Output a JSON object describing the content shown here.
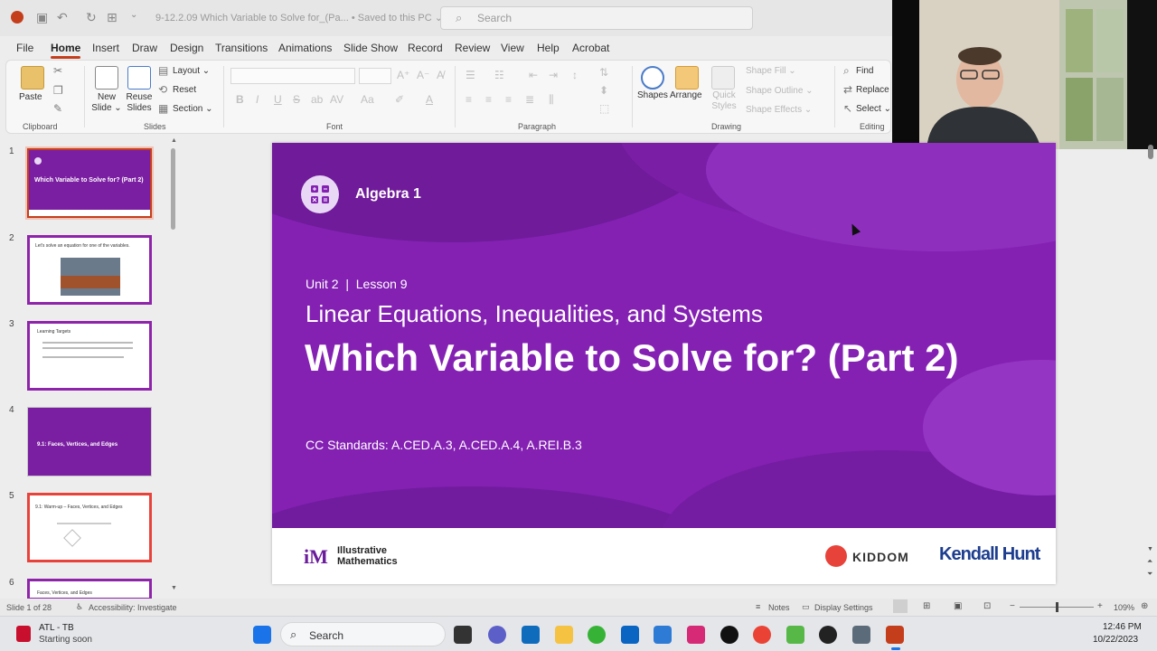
{
  "titlebar": {
    "doc_title": "9-12.2.09 Which Variable to Solve for_(Pa... • Saved to this PC ⌄",
    "search_placeholder": "Search"
  },
  "tabs": [
    "File",
    "Home",
    "Insert",
    "Draw",
    "Design",
    "Transitions",
    "Animations",
    "Slide Show",
    "Record",
    "Review",
    "View",
    "Help",
    "Acrobat"
  ],
  "active_tab": "Home",
  "ribbon": {
    "clipboard": {
      "paste": "Paste",
      "label": "Clipboard"
    },
    "slides": {
      "new_slide": "New Slide ⌄",
      "reuse_slides": "Reuse Slides",
      "layout": "Layout ⌄",
      "reset": "Reset",
      "section": "Section ⌄",
      "label": "Slides"
    },
    "font": {
      "label": "Font",
      "bold": "B",
      "italic": "I",
      "underline": "U",
      "strike": "S",
      "shadow": "ab",
      "spacing": "AV",
      "case": "Aa",
      "color": "A"
    },
    "paragraph": {
      "label": "Paragraph"
    },
    "drawing": {
      "shapes": "Shapes",
      "arrange": "Arrange",
      "quick_styles": "Quick Styles",
      "shape_fill": "Shape Fill ⌄",
      "shape_outline": "Shape Outline ⌄",
      "shape_effects": "Shape Effects ⌄",
      "label": "Drawing"
    },
    "editing": {
      "find": "Find",
      "replace": "Replace",
      "select": "Select ⌄",
      "label": "Editing"
    }
  },
  "thumbnails": [
    {
      "num": "1",
      "title": "Which Variable to Solve for? (Part 2)",
      "kind": "purple"
    },
    {
      "num": "2",
      "title": "Let's solve an equation for one of the variables.",
      "kind": "photo"
    },
    {
      "num": "3",
      "title": "Learning Targets",
      "kind": "white"
    },
    {
      "num": "4",
      "title": "9.1: Faces, Vertices, and Edges",
      "kind": "purple"
    },
    {
      "num": "5",
      "title": "9.1: Warm-up – Faces, Vertices, and Edges",
      "kind": "red"
    },
    {
      "num": "6",
      "title": "Faces, Vertices, and Edges",
      "kind": "white"
    }
  ],
  "slide": {
    "course": "Algebra 1",
    "unit_lesson": "Unit 2  |  Lesson 9",
    "subtitle": "Linear Equations, Inequalities, and Systems",
    "title": "Which Variable to Solve for? (Part 2)",
    "standards": "CC Standards: A.CED.A.3, A.CED.A.4, A.REI.B.3",
    "logo_im": "Illustrative Mathematics",
    "logo_kiddom": "KIDDOM",
    "logo_kendall": "Kendall Hunt"
  },
  "statusbar": {
    "slide_of": "Slide 1 of 28",
    "accessibility": "Accessibility: Investigate",
    "notes": "Notes",
    "display_settings": "Display Settings",
    "zoom": "109%"
  },
  "taskbar": {
    "weather_title": "ATL - TB",
    "weather_sub": "Starting soon",
    "search": "Search",
    "time": "12:46 PM",
    "date": "10/22/2023"
  },
  "colors": {
    "slide_purple": "#8421b3",
    "accent_red": "#c43e1c",
    "im_purple": "#6b1c9b",
    "kiddom_red": "#e8433b",
    "kendall_blue": "#1d3d8f"
  }
}
